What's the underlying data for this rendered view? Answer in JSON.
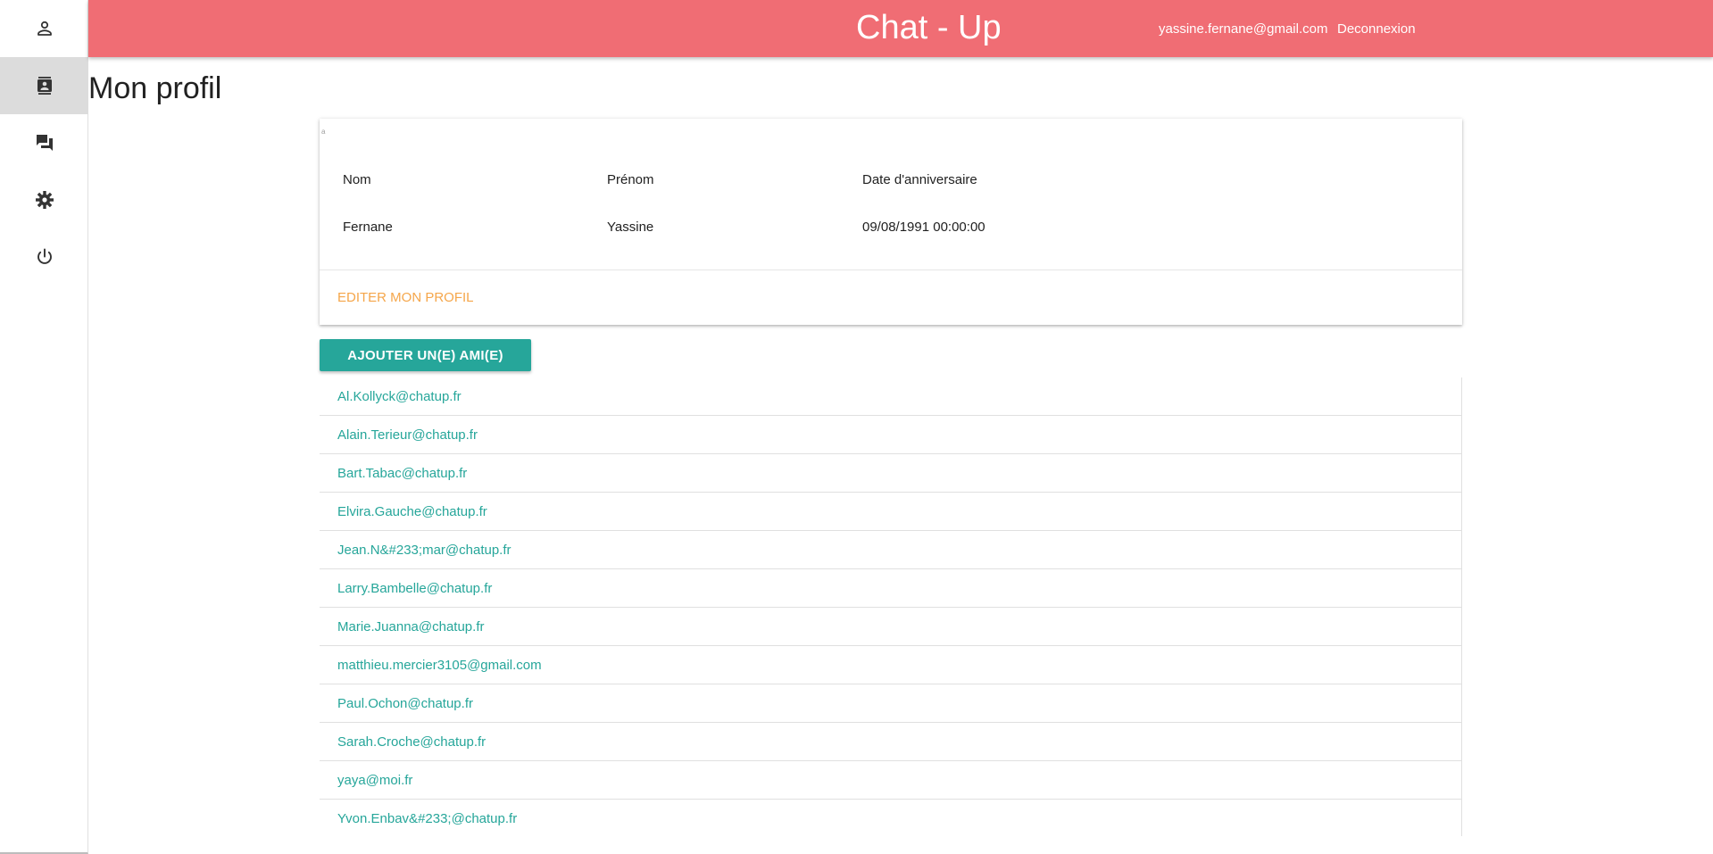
{
  "colors": {
    "header_bg": "#f06d74",
    "accent_teal": "#26a69a",
    "edit_orange": "#f5a64a",
    "sidebar_active": "#dcdcdc"
  },
  "sidebar": {
    "items": [
      {
        "icon": "person-outline-icon"
      },
      {
        "icon": "contacts-icon",
        "active": true
      },
      {
        "icon": "forum-icon"
      },
      {
        "icon": "gear-icon"
      },
      {
        "icon": "power-icon"
      }
    ]
  },
  "header": {
    "title": "Chat - Up",
    "user_email": "yassine.fernane@gmail.com",
    "logout_label": "Deconnexion"
  },
  "page": {
    "title": "Mon profil"
  },
  "profile": {
    "tiny_mark": "a",
    "labels": {
      "nom": "Nom",
      "prenom": "Prénom",
      "birthday": "Date d'anniversaire"
    },
    "values": {
      "nom": "Fernane",
      "prenom": "Yassine",
      "birthday": "09/08/1991 00:00:00"
    },
    "edit_label": "EDITER MON PROFIL"
  },
  "friends": {
    "add_button_label": "AJOUTER UN(E) AMI(E)",
    "list": [
      "Al.Kollyck@chatup.fr",
      "Alain.Terieur@chatup.fr",
      "Bart.Tabac@chatup.fr",
      "Elvira.Gauche@chatup.fr",
      "Jean.N&#233;mar@chatup.fr",
      "Larry.Bambelle@chatup.fr",
      "Marie.Juanna@chatup.fr",
      "matthieu.mercier3105@gmail.com",
      "Paul.Ochon@chatup.fr",
      "Sarah.Croche@chatup.fr",
      "yaya@moi.fr",
      "Yvon.Enbav&#233;@chatup.fr"
    ]
  }
}
